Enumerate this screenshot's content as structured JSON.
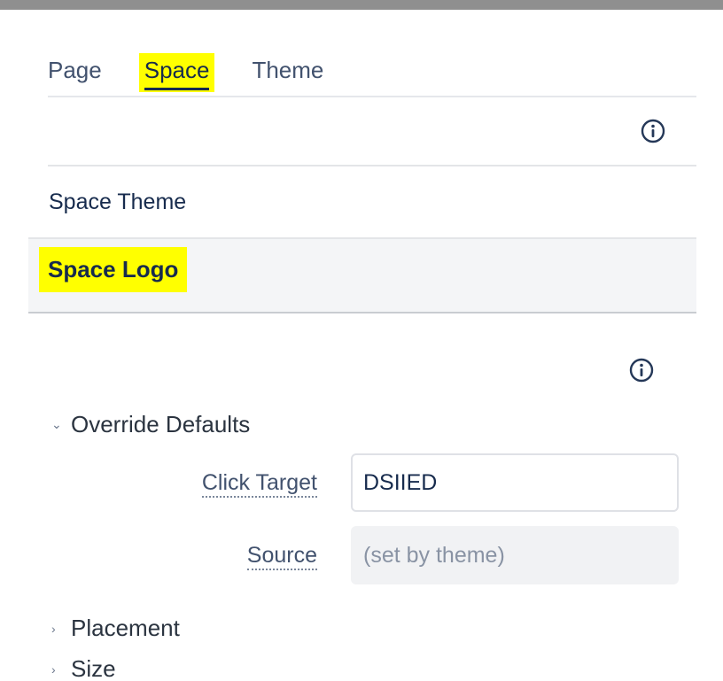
{
  "tabs": [
    {
      "label": "Page",
      "active": false
    },
    {
      "label": "Space",
      "active": true
    },
    {
      "label": "Theme",
      "active": false
    }
  ],
  "sections": {
    "space_theme": "Space Theme",
    "space_logo": "Space Logo"
  },
  "override_defaults": {
    "label": "Override Defaults",
    "expanded": true,
    "chevron": "chevron-down-icon",
    "fields": {
      "click_target": {
        "label": "Click Target",
        "value": "DSIIED"
      },
      "source": {
        "label": "Source",
        "placeholder": "(set by theme)"
      }
    }
  },
  "collapsed_groups": [
    {
      "label": "Placement",
      "chevron": "chevron-right-icon"
    },
    {
      "label": "Size",
      "chevron": "chevron-right-icon"
    }
  ],
  "colors": {
    "highlight": "#ffff00",
    "text": "#172b4d",
    "muted": "#42526e",
    "panel_bg": "#f4f5f7"
  }
}
